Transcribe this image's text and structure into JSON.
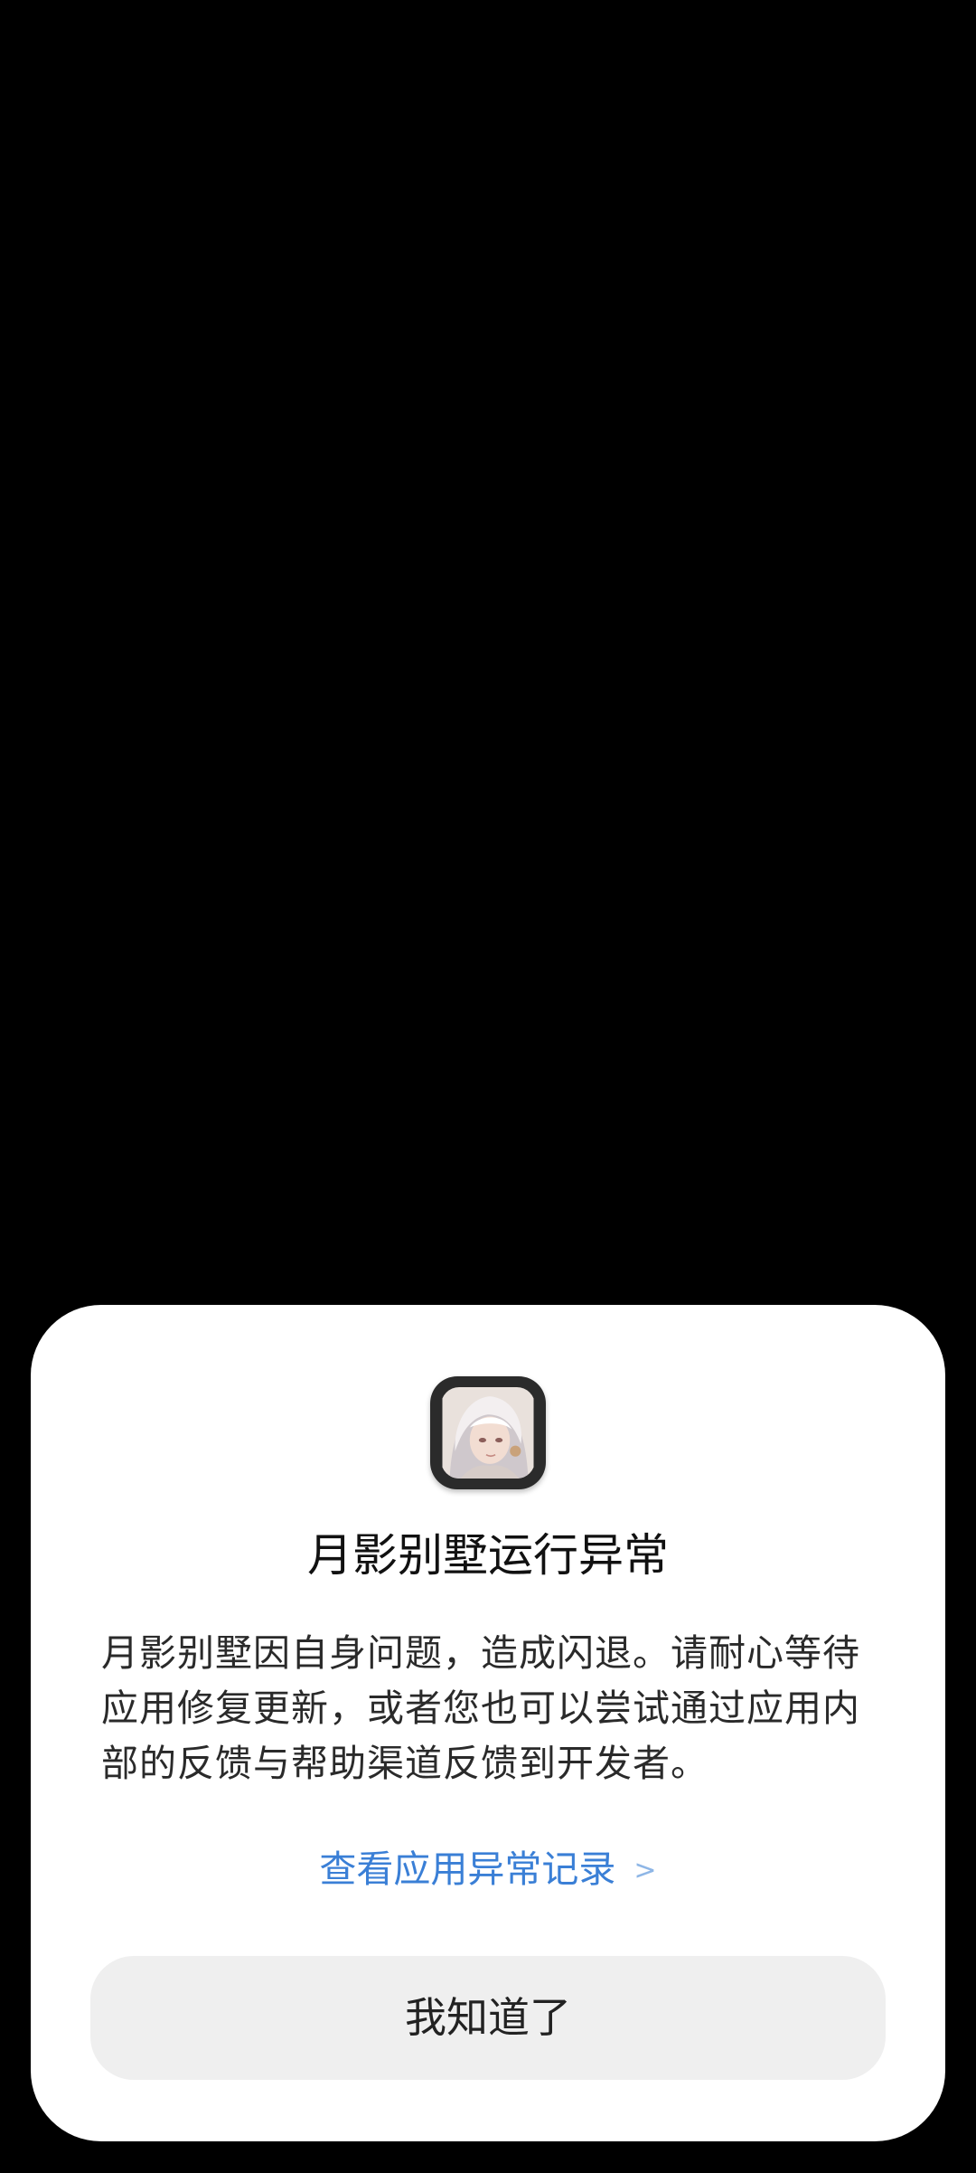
{
  "dialog": {
    "app_icon": "app-character-portrait-icon",
    "title": "月影别墅运行异常",
    "message": "月影别墅因自身问题，造成闪退。请耐心等待应用修复更新，或者您也可以尝试通过应用内部的反馈与帮助渠道反馈到开发者。",
    "record_link": "查看应用异常记录",
    "record_link_chevron": ">",
    "ok_button": "我知道了"
  },
  "colors": {
    "background": "#000000",
    "dialog": "#ffffff",
    "link": "#3a7fd6",
    "button": "#efefef"
  }
}
